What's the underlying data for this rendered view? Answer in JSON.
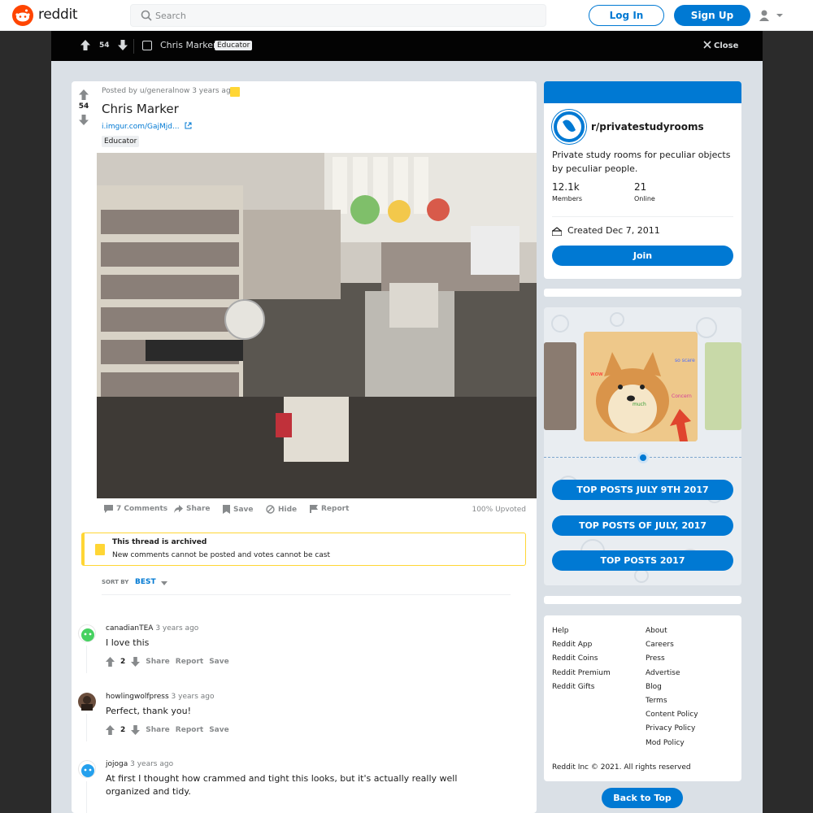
{
  "header": {
    "logo_text": "reddit",
    "search_placeholder": "Search",
    "login_label": "Log In",
    "signup_label": "Sign Up"
  },
  "postbar": {
    "score": "54",
    "title": "Chris Marker",
    "flair": "Educator",
    "close_label": "Close"
  },
  "post": {
    "score": "54",
    "posted_by": "Posted by u/generalnow 3 years ago",
    "title": "Chris Marker",
    "link": "i.imgur.com/GajMjd...",
    "flair": "Educator",
    "actions": {
      "comments": "7 Comments",
      "share": "Share",
      "save": "Save",
      "hide": "Hide",
      "report": "Report"
    },
    "upvoted": "100% Upvoted"
  },
  "archived": {
    "title": "This thread is archived",
    "subtitle": "New comments cannot be posted and votes cannot be cast"
  },
  "sort": {
    "label": "SORT BY",
    "value": "BEST"
  },
  "comments": [
    {
      "author": "canadianTEA",
      "time": "3 years ago",
      "body": "I love this",
      "score": "2",
      "share": "Share",
      "report": "Report",
      "save": "Save"
    },
    {
      "author": "howlingwolfpress",
      "time": "3 years ago",
      "body": "Perfect, thank you!",
      "score": "2",
      "share": "Share",
      "report": "Report",
      "save": "Save"
    },
    {
      "author": "jojoga",
      "time": "3 years ago",
      "body": "At first I thought how crammed and tight this looks, but it's actually really well organized and tidy."
    }
  ],
  "sidebar": {
    "community_name": "r/privatestudyrooms",
    "description": "Private study rooms for peculiar objects by peculiar people.",
    "members_count": "12.1k",
    "members_label": "Members",
    "online_count": "21",
    "online_label": "Online",
    "created": "Created Dec 7, 2011",
    "join_label": "Join"
  },
  "promo": {
    "meme_text_1": "so scare",
    "meme_text_2": "Concern",
    "meme_text_3": "much",
    "meme_text_4": "wow",
    "buttons": [
      "TOP POSTS JULY 9TH 2017",
      "TOP POSTS OF JULY, 2017",
      "TOP POSTS 2017"
    ]
  },
  "footer": {
    "col1": [
      "Help",
      "Reddit App",
      "Reddit Coins",
      "Reddit Premium",
      "Reddit Gifts"
    ],
    "col2": [
      "About",
      "Careers",
      "Press",
      "Advertise",
      "Blog",
      "Terms",
      "Content Policy",
      "Privacy Policy",
      "Mod Policy"
    ],
    "copyright": "Reddit Inc © 2021. All rights reserved",
    "back_to_top": "Back to Top"
  },
  "colors": {
    "brand": "#ff4500",
    "accent": "#0079d3",
    "archived": "#ffd635"
  }
}
